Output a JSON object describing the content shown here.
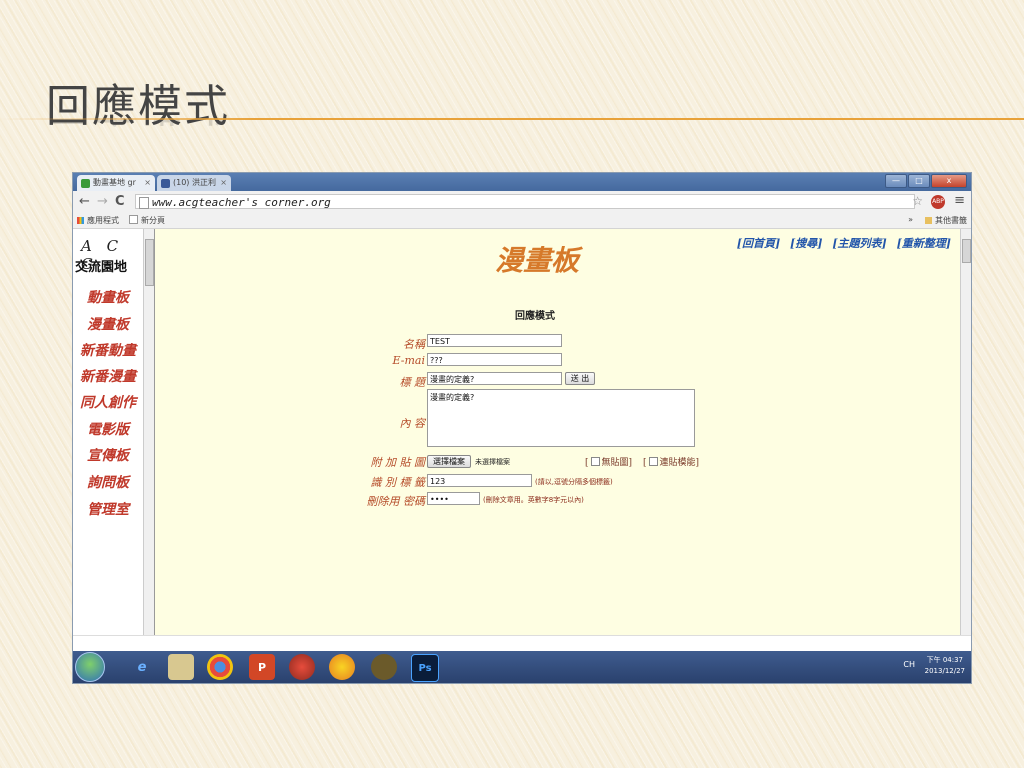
{
  "slide": {
    "title": "回應模式"
  },
  "browser": {
    "tabs": [
      {
        "label": "動畫基地 gr",
        "close": "×"
      },
      {
        "label": "(10) 洪正利",
        "close": "×"
      }
    ],
    "window_buttons": {
      "minimize": "—",
      "maximize": "□",
      "close": "x"
    },
    "nav": {
      "back": "←",
      "forward": "→",
      "reload": "C"
    },
    "url": "www.acgteacher's corner.org",
    "star": "☆",
    "extension_badge": "ABP",
    "menu": "≡",
    "bookmarks": [
      {
        "label": "應用程式"
      },
      {
        "label": "新分頁"
      }
    ],
    "bookmarks_right": "»",
    "other_bookmarks": "其他書籤"
  },
  "sidebar": {
    "logo": "A C G",
    "site_name": "交流園地",
    "items": [
      "動畫板",
      "漫畫板",
      "新番動畫",
      "新番漫畫",
      "同人創作",
      "電影版",
      "宣傳板",
      "詢問板",
      "管理室"
    ]
  },
  "main": {
    "top_links": [
      "[回首頁]",
      "[搜尋]",
      "[主題列表]",
      "[重新整理]"
    ],
    "board_title": "漫畫板",
    "mode": "回應模式",
    "form": {
      "name_label": "名稱",
      "name_value": "TEST",
      "email_label": "E-mai",
      "email_value": "???",
      "subject_label": "標 題",
      "subject_value": "漫畫的定義?",
      "submit_label": "送 出",
      "content_label": "內 容",
      "content_value": "漫畫的定義?",
      "attach_label": "附 加 貼 圖",
      "choose_file_label": "選擇檔案",
      "no_file_text": "未選擇檔案",
      "no_image_label": "無貼圖",
      "link_label": "連貼模能",
      "tags_label": "識 別 標 籤",
      "tags_value": "123",
      "tags_hint": "(請以,逗號分隔多個標籤)",
      "password_label": "刪除用 密碼",
      "password_value": "••••",
      "password_hint": "(刪除文章用。英數字8字元以內)"
    }
  },
  "taskbar": {
    "apps": [
      "ie",
      "explorer",
      "chrome",
      "powerpoint",
      "game",
      "pidgin",
      "beetle",
      "photoshop"
    ],
    "ps_label": "Ps",
    "tray_text": "CH",
    "time": "下午 04:37",
    "date": "2013/12/27"
  }
}
